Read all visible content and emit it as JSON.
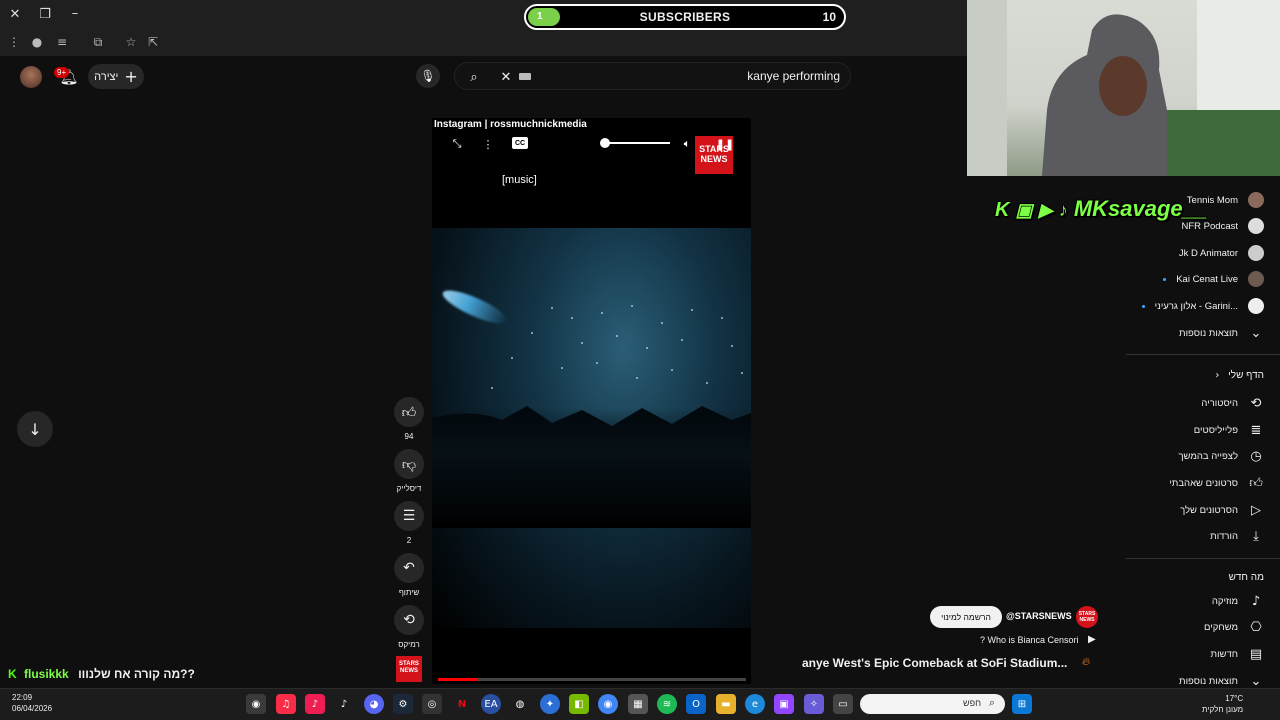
{
  "browser": {
    "window_buttons": [
      "close-icon",
      "restore-icon",
      "minimize-icon"
    ]
  },
  "overlay": {
    "subscribers": {
      "label": "SUBSCRIBERS",
      "progress_value": "1",
      "count": "10",
      "progress_fraction": 0.1
    },
    "social_handle": "MKsavage__",
    "chat": {
      "user": "flusikkk",
      "message": "מה קורה אח שלנווו??"
    }
  },
  "header": {
    "create_label": "יצירה",
    "notification_count": "9+",
    "search_value": "kanye performing"
  },
  "video": {
    "source_text": "Instagram | rossmuchnickmedia",
    "caption": "[music]",
    "cc_label": "CC",
    "logo_text": "STARS NEWS",
    "progress_fraction": 0.13
  },
  "actions": {
    "likes": "94",
    "dislike_label": "דיסלייק",
    "comments": "2",
    "share_label": "שיתוף",
    "remix_label": "רמיקס"
  },
  "short": {
    "subscribe_label": "הרשמה למינוי",
    "channel_handle": "@STARSNEWS",
    "question": "? Who is Bianca Censori",
    "title": "anye West's Epic Comeback at SoFi Stadium..."
  },
  "sidebar": {
    "channels": [
      {
        "name": "Tennis Mom"
      },
      {
        "name": "NFR Podcast"
      },
      {
        "name": "Jk D Animator"
      },
      {
        "name": "Kai Cenat Live"
      },
      {
        "name": "אלון גרעיני - Garini..."
      }
    ],
    "more_results": "תוצאות נוספות",
    "you_heading": "הדף שלי",
    "you_items": [
      {
        "label": "היסטוריה",
        "icon": "history-icon"
      },
      {
        "label": "פלייליסטים",
        "icon": "playlist-icon"
      },
      {
        "label": "לצפייה בהמשך",
        "icon": "clock-icon"
      },
      {
        "label": "סרטונים שאהבתי",
        "icon": "thumb-up-icon"
      },
      {
        "label": "הסרטונים שלך",
        "icon": "your-videos-icon"
      },
      {
        "label": "הורדות",
        "icon": "download-icon"
      }
    ],
    "explore_heading": "מה חדש",
    "explore_items": [
      {
        "label": "מוזיקה",
        "icon": "music-icon"
      },
      {
        "label": "משחקים",
        "icon": "gaming-icon"
      },
      {
        "label": "חדשות",
        "icon": "news-icon"
      }
    ],
    "more_results_2": "תוצאות נוספות"
  },
  "taskbar": {
    "time": "22:09",
    "date": "06/04/2026",
    "search_placeholder": "חפש",
    "temperature": "17°C",
    "weather_text": "מעונן חלקית"
  },
  "colors": {
    "accent_red": "#ff0000",
    "stars_news_red": "#d4121a",
    "overlay_green": "#7dff46"
  }
}
